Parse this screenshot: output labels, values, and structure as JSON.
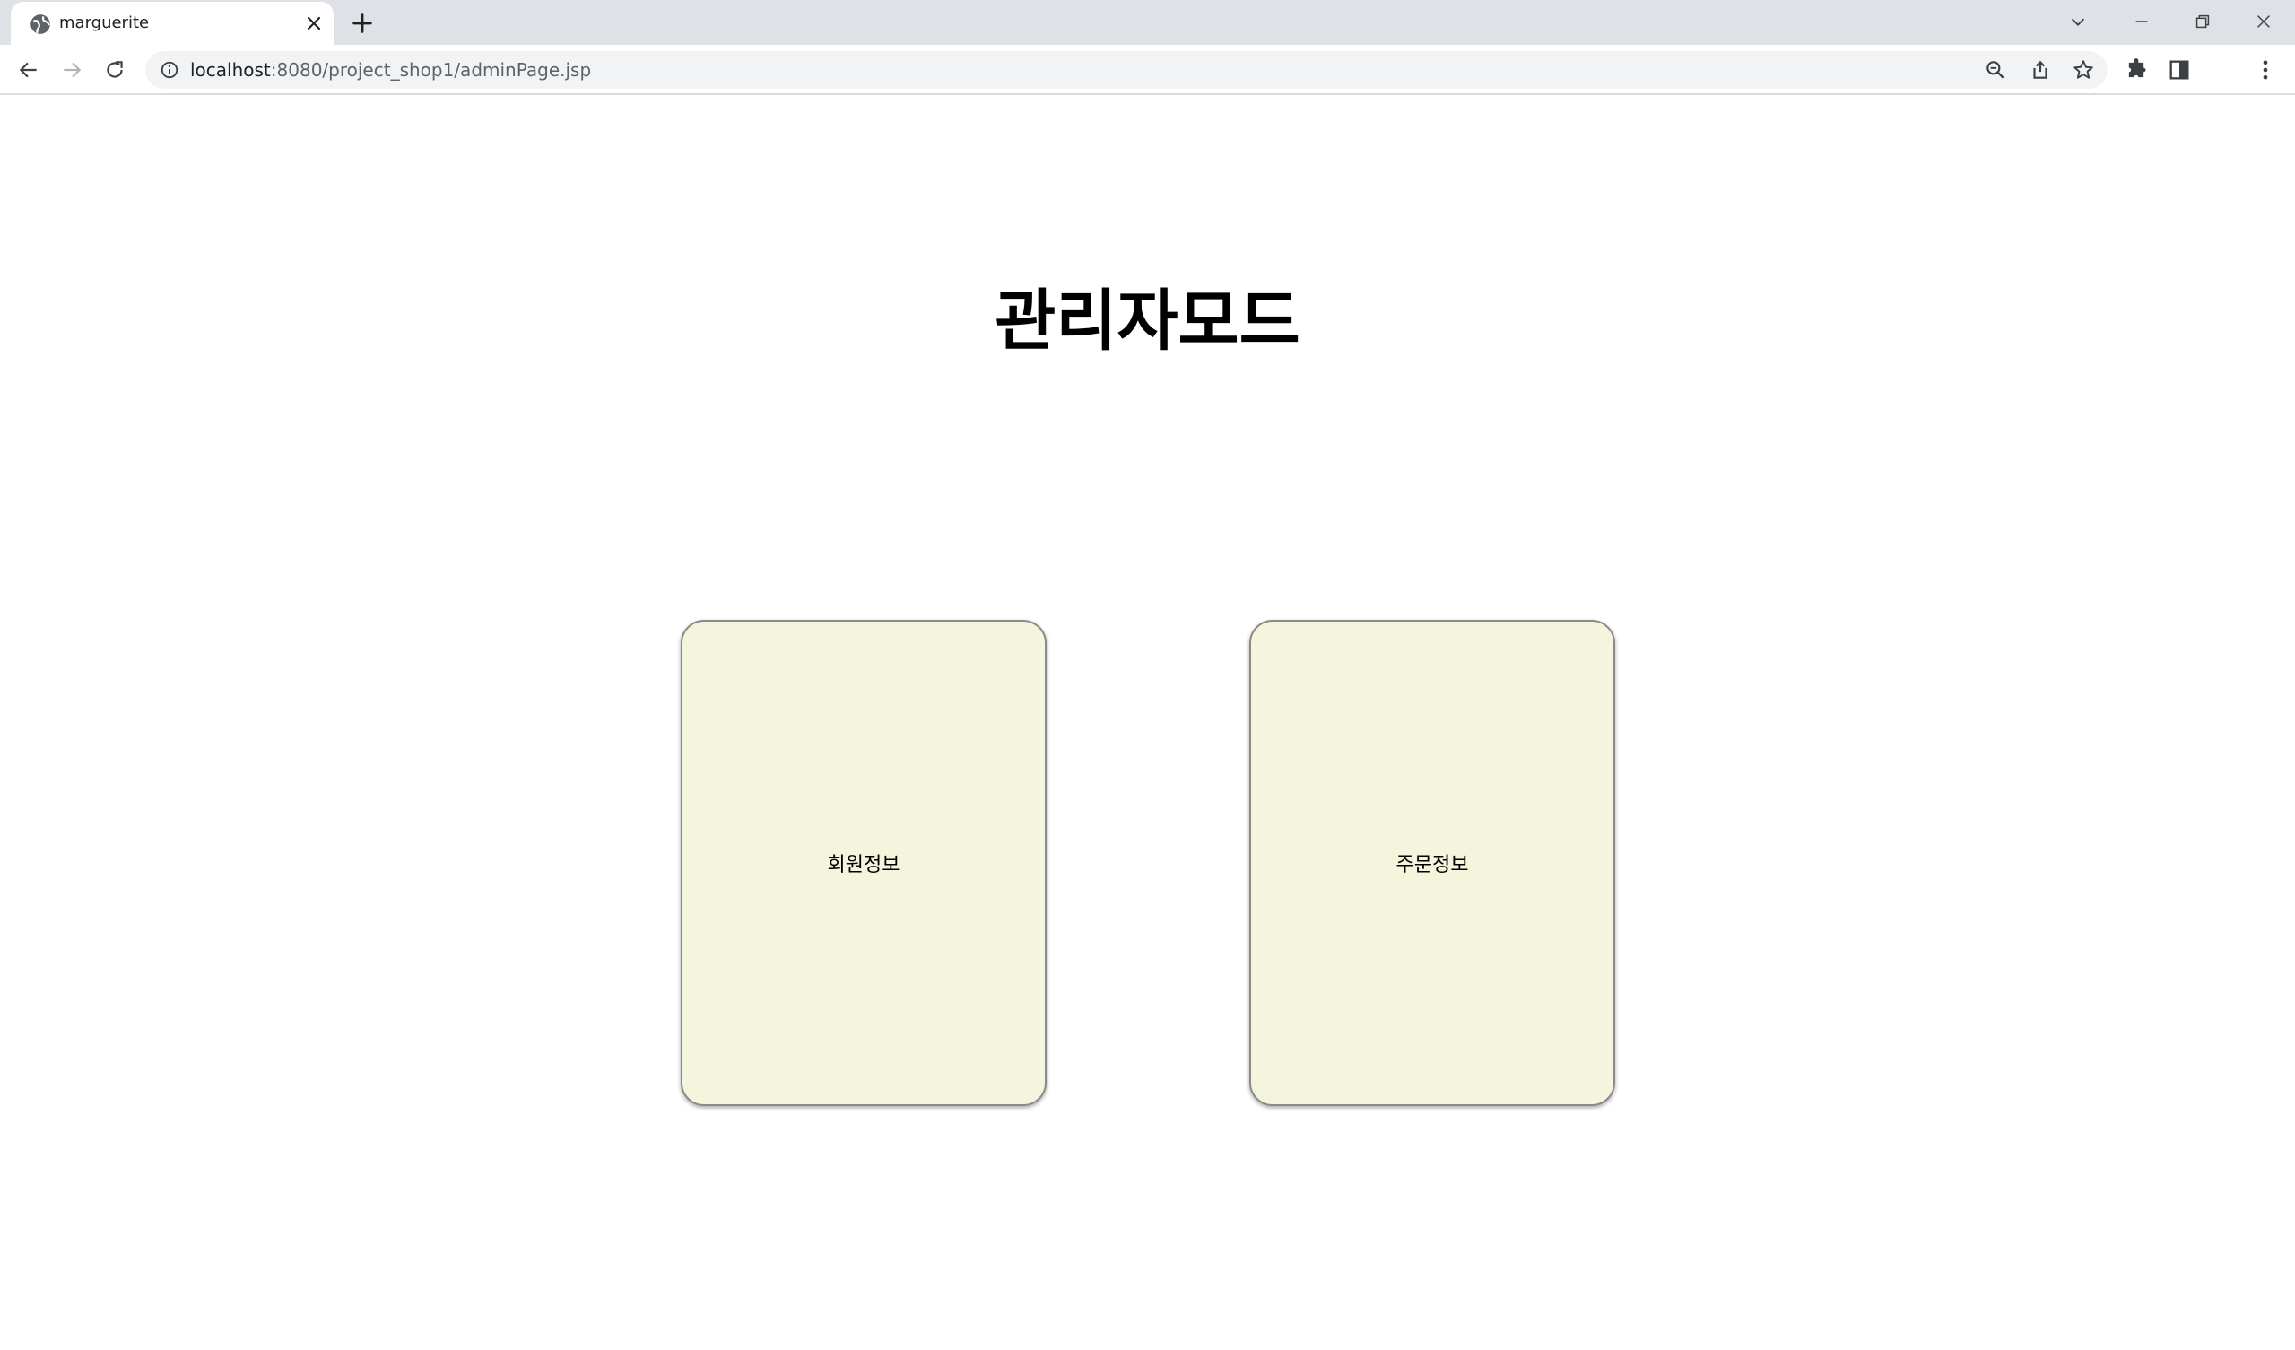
{
  "browser": {
    "tab_title": "marguerite",
    "url_host": "localhost",
    "url_path": ":8080/project_shop1/adminPage.jsp"
  },
  "page": {
    "title": "관리자모드",
    "cards": [
      {
        "label": "회원정보"
      },
      {
        "label": "주문정보"
      }
    ]
  },
  "colors": {
    "card_background": "#f5f4dc",
    "card_border": "#8a8a8a",
    "tabstrip": "#dee1e6"
  }
}
